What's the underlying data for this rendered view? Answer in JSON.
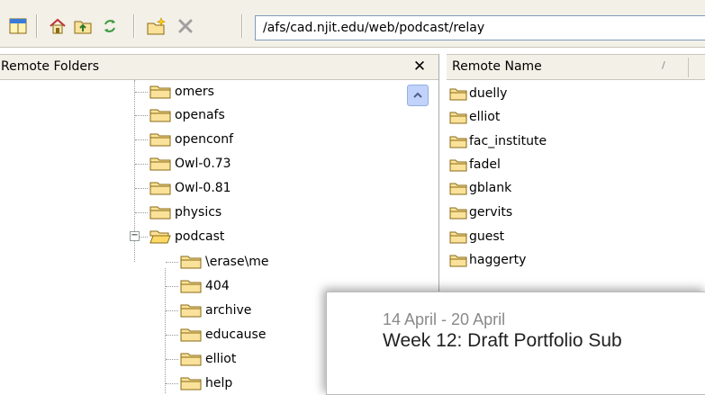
{
  "toolbar": {
    "buttons": [
      {
        "name": "panes-icon"
      },
      {
        "name": "home-icon"
      },
      {
        "name": "up-folder-icon"
      },
      {
        "name": "refresh-icon"
      },
      {
        "name": "new-folder-icon"
      },
      {
        "name": "delete-icon"
      }
    ],
    "path": "/afs/cad.njit.edu/web/podcast/relay"
  },
  "remote_folders": {
    "title": "Remote Folders",
    "close_glyph": "✕",
    "items": [
      {
        "label": "omers"
      },
      {
        "label": "openafs"
      },
      {
        "label": "openconf"
      },
      {
        "label": "Owl-0.73"
      },
      {
        "label": "Owl-0.81"
      },
      {
        "label": "physics"
      },
      {
        "label": "podcast",
        "expanded": true,
        "expander": "−"
      },
      {
        "label": "\\erase\\me"
      },
      {
        "label": "404"
      },
      {
        "label": "archive"
      },
      {
        "label": "educause"
      },
      {
        "label": "elliot"
      },
      {
        "label": "help"
      }
    ]
  },
  "remote_files": {
    "column_header": "Remote Name",
    "sort_glyph": "/",
    "items": [
      {
        "label": "duelly"
      },
      {
        "label": "elliot"
      },
      {
        "label": "fac_institute"
      },
      {
        "label": "fadel"
      },
      {
        "label": "gblank"
      },
      {
        "label": "gervits"
      },
      {
        "label": "guest"
      },
      {
        "label": "haggerty"
      }
    ]
  },
  "overlay": {
    "date_range": "14 April - 20 April",
    "title": "Week 12: Draft Portfolio Sub"
  },
  "colors": {
    "folder_fill": "#fbe29a",
    "folder_stroke": "#8a6a14",
    "toolbar_bg": "#f3f0e8",
    "scroll_accent": "#c1d3fb"
  }
}
